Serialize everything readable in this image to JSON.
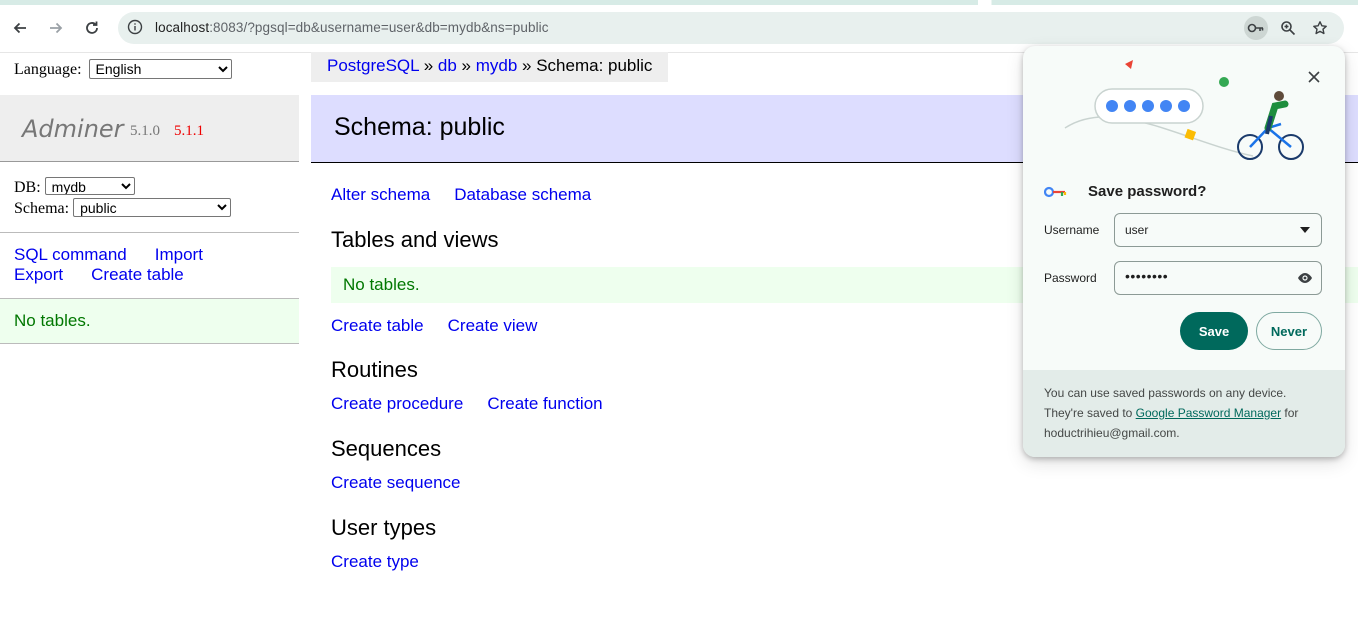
{
  "browser": {
    "url_host": "localhost",
    "url_rest": ":8083/?pgsql=db&username=user&db=mydb&ns=public",
    "back_icon": "back-arrow-icon",
    "forward_icon": "forward-arrow-icon",
    "reload_icon": "reload-icon"
  },
  "sidebar": {
    "language_label": "Language:",
    "language_value": "English",
    "brand_name": "Adminer",
    "version": "5.1.0",
    "new_version": "5.1.1",
    "db_label": "DB:",
    "db_value": "mydb",
    "schema_label": "Schema:",
    "schema_value": "public",
    "links": {
      "sql_command": "SQL command",
      "import": "Import",
      "export": "Export",
      "create_table": "Create table"
    },
    "message": "No tables."
  },
  "breadcrumb": {
    "driver": "PostgreSQL",
    "sep1": " » ",
    "server": "db",
    "sep2": " » ",
    "database": "mydb",
    "sep3": " » ",
    "current": "Schema: public"
  },
  "main": {
    "title": "Schema: public",
    "top_links": {
      "alter_schema": "Alter schema",
      "database_schema": "Database schema"
    },
    "tables_heading": "Tables and views",
    "tables_message": "No tables.",
    "tables_links": {
      "create_table": "Create table",
      "create_view": "Create view"
    },
    "routines_heading": "Routines",
    "routines_links": {
      "create_procedure": "Create procedure",
      "create_function": "Create function"
    },
    "sequences_heading": "Sequences",
    "sequences_link": "Create sequence",
    "user_types_heading": "User types",
    "user_types_link": "Create type"
  },
  "password_bubble": {
    "title": "Save password?",
    "username_label": "Username",
    "username_value": "user",
    "password_label": "Password",
    "password_value": "••••••••",
    "save_label": "Save",
    "never_label": "Never",
    "footer_before": "You can use saved passwords on any device. They're saved to ",
    "footer_link": "Google Password Manager",
    "footer_after": " for hoductrihieu@gmail.com.",
    "accent_color": "#00695c"
  }
}
